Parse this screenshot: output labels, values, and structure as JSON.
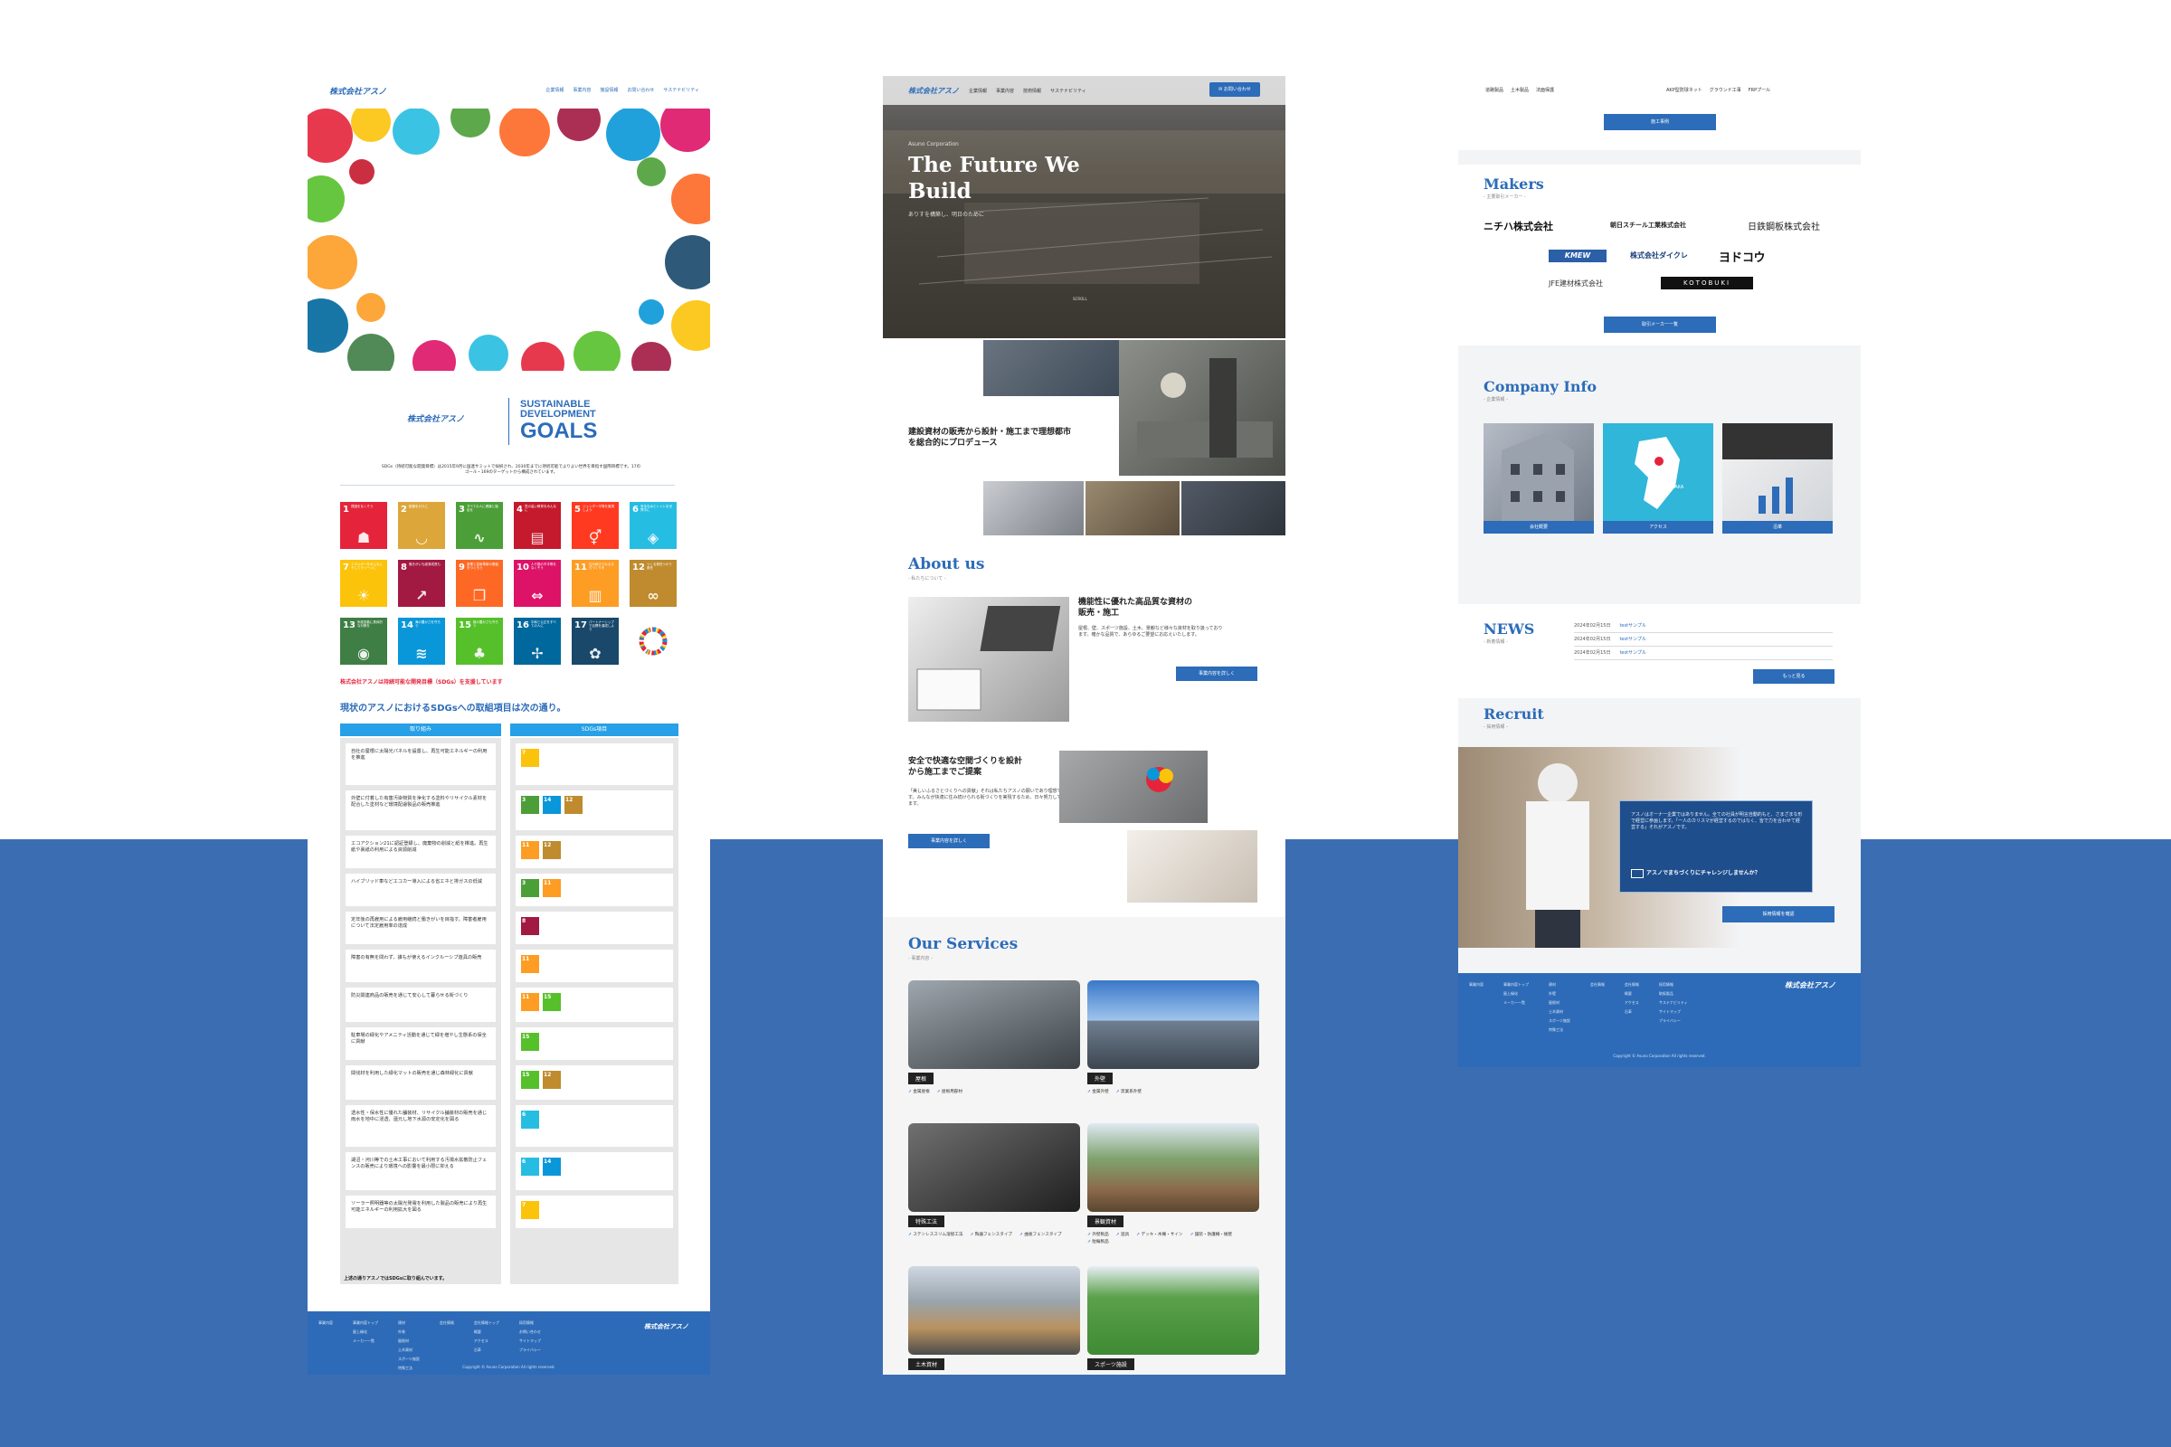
{
  "colors": {
    "band": "#3b6db3",
    "brand": "#2c6cb9",
    "sdg_red": "#e5243b"
  },
  "p1": {
    "logo": "株式会社アスノ",
    "nav": [
      "企業情報",
      "事業内容",
      "施設情報",
      "お問い合わせ",
      "サステナビリティ"
    ],
    "sdg_logo_line1": "SUSTAINABLE",
    "sdg_logo_line2": "DEVELOPMENT",
    "sdg_logo_line3": "GOALS",
    "intro": "SDGs（持続可能な開発目標）は2015年9月に国連サミットで採択され、2030年までに持続可能でよりよい世界を目指す国際目標です。17のゴール・169のターゲットから構成されています。",
    "support": "株式会社アスノは持続可能な開発目標（SDGs）を支援しています",
    "heading": "現状のアスノにおけるSDGsへの取組項目は次の通り。",
    "col1": "取り組み",
    "col2": "SDGs項目",
    "rows": [
      "自社の屋根に太陽光パネルを設置し、再生可能エネルギーの利用を推進",
      "外壁に付着した有害汚染物質を浄化する塗料やリサイクル素材を配合した塗材など環境配慮製品の販売推進",
      "エコアクション21に認証登録し、廃棄物の削減と紙を推進。再生紙や裏紙の利用による資源削減",
      "ハイブリッド車などエコカー導入による省エネと排ガスの低減",
      "定年後の再雇用による雇用継続と働きがいを目指す。障害者雇用について法定雇用率の達成",
      "障害の有無を問わず、誰もが使えるインクルーシブ遊具の販売",
      "防災関連商品の販売を通じて安心して暮らせる街づくり",
      "駐車場の緑化やアメニティ活動を通じて緑を増やし生態系の保全に貢献",
      "間伐材を利用した緑化マットの販売を通じ森林緑化に貢献",
      "透水性・保水性に優れた舗装材、リサイクル舗装材の販売を通じ雨水を地中に浸透、還元し地下水源の安定化を図る",
      "湖沼・河川等での土木工事において利用する汚濁水拡散防止フェンスの販売により環境への影響を最小限に抑える",
      "ソーラー照明器等の太陽光発電を利用した製品の販売により再生可能エネルギーの利用拡大を図る"
    ],
    "closing": "上述の通りアスノではSDGsに取り組んでいます。",
    "footer_cols": [
      [
        "事業内容"
      ],
      [
        "事業内容トップ",
        "屋上緑化",
        "メーカー一覧"
      ],
      [
        "建材",
        "外装",
        "屋根材",
        "土木資材",
        "スポーツ施設",
        "特殊工法"
      ],
      [
        "会社情報"
      ],
      [
        "会社情報トップ",
        "概要",
        "アクセス",
        "沿革"
      ],
      [
        "採用情報",
        "お問い合わせ",
        "サイトマップ",
        "プライバシー"
      ]
    ],
    "copyright": "Copyright © Asuno Corporation All rights reserved."
  },
  "sdg_goals": [
    {
      "n": "1",
      "label": "貧困をなくそう",
      "color": "#e5243b",
      "icon": "family-icon"
    },
    {
      "n": "2",
      "label": "飢餓をゼロに",
      "color": "#dda63a",
      "icon": "bowl-icon"
    },
    {
      "n": "3",
      "label": "すべての人に健康と福祉を",
      "color": "#4c9f38",
      "icon": "heartbeat-icon"
    },
    {
      "n": "4",
      "label": "質の高い教育をみんなに",
      "color": "#c5192d",
      "icon": "book-icon"
    },
    {
      "n": "5",
      "label": "ジェンダー平等を実現しよう",
      "color": "#ff3a21",
      "icon": "gender-icon"
    },
    {
      "n": "6",
      "label": "安全な水とトイレを世界中に",
      "color": "#26bde2",
      "icon": "water-icon"
    },
    {
      "n": "7",
      "label": "エネルギーをみんなにそしてクリーンに",
      "color": "#fcc30b",
      "icon": "sun-icon"
    },
    {
      "n": "8",
      "label": "働きがいも経済成長も",
      "color": "#a21942",
      "icon": "growth-icon"
    },
    {
      "n": "9",
      "label": "産業と技術革新の基盤をつくろう",
      "color": "#fd6925",
      "icon": "cubes-icon"
    },
    {
      "n": "10",
      "label": "人や国の不平等をなくそう",
      "color": "#dd1367",
      "icon": "equality-icon"
    },
    {
      "n": "11",
      "label": "住み続けられるまちづくりを",
      "color": "#fd9d24",
      "icon": "city-icon"
    },
    {
      "n": "12",
      "label": "つくる責任つかう責任",
      "color": "#bf8b2e",
      "icon": "infinity-icon"
    },
    {
      "n": "13",
      "label": "気候変動に具体的な対策を",
      "color": "#3f7e44",
      "icon": "eye-icon"
    },
    {
      "n": "14",
      "label": "海の豊かさを守ろう",
      "color": "#0a97d9",
      "icon": "fish-icon"
    },
    {
      "n": "15",
      "label": "陸の豊かさも守ろう",
      "color": "#56c02b",
      "icon": "tree-icon"
    },
    {
      "n": "16",
      "label": "平和と公正をすべての人に",
      "color": "#00689d",
      "icon": "dove-icon"
    },
    {
      "n": "17",
      "label": "パートナーシップで目標を達成しよう",
      "color": "#19486a",
      "icon": "flower-icon"
    }
  ],
  "p2": {
    "logo": "株式会社アスノ",
    "nav": [
      "企業情報",
      "事業内容",
      "技術情報",
      "サステナビリティ"
    ],
    "contact": "お問い合わせ",
    "hero_kicker": "Asuno Corporation",
    "hero_title1": "The Future We",
    "hero_title2": "Build",
    "hero_sub": "ありすを構築し、明日のために",
    "scroll": "SCROLL",
    "tagline1": "建設資材の販売から設計・施工まで理想都市",
    "tagline2": "を総合的にプロデュース",
    "about_title": "About us",
    "about_sub": "- 私たちについて -",
    "about_h1": "機能性に優れた高品質な資材の",
    "about_h2": "販売・施工",
    "about_body": "屋根、壁、スポーツ施設、土木、景観など様々な資材を取り扱っております。確かな品質で、あらゆるご要望にお応えいたします。",
    "about_btn": "事業内容を詳しく",
    "safe_h1": "安全で快適な空間づくりを設計",
    "safe_h2": "から施工までご提案",
    "safe_body": "「美しいふるさとづくりへの貢献」それは私たちアスノの願いであり理想です。みんなが快適に住み続けられる街づくりを実現するため、日々努力しています。",
    "safe_btn": "事業内容を詳しく",
    "services_title": "Our Services",
    "services_sub": "- 事業内容 -",
    "services": [
      {
        "name": "屋根",
        "tags": [
          "金属屋根",
          "屋根用部材"
        ]
      },
      {
        "name": "外壁",
        "tags": [
          "金属外壁",
          "窯業系外壁"
        ]
      },
      {
        "name": "特殊工法",
        "tags": [
          "ステンレススリム溶接工法",
          "陶器フェンスタイプ",
          "曲板フェンスタイプ"
        ]
      },
      {
        "name": "景観資材",
        "tags": [
          "外壁製品",
          "遊具",
          "デッキ・木柵・サイン",
          "舗装・防護柵・擁壁",
          "駐輪製品"
        ]
      },
      {
        "name": "土木資材",
        "tags": [
          "道路製品",
          "土木製品",
          "法面保護"
        ]
      },
      {
        "name": "スポーツ施設",
        "tags": [
          "AKP型球技ネット",
          "グラウンド工事",
          "FRPプール"
        ]
      }
    ]
  },
  "p3": {
    "top_tags_left": [
      "道路製品",
      "土木製品",
      "法面保護"
    ],
    "top_tags_right": [
      "AKP型防球ネット",
      "グラウンド工事",
      "FRPプール"
    ],
    "works_btn": "施工事例",
    "makers_title": "Makers",
    "makers_sub": "- 主要取引メーカー -",
    "makers": [
      "ニチハ株式会社",
      "朝日スチール工業株式会社",
      "日鉄鋼板株式会社",
      "KMEW",
      "株式会社ダイクレ",
      "ヨドコウ",
      "JFE建材株式会社",
      "KOTOBUKI"
    ],
    "makers_btn": "取引メーカー一覧",
    "company_title": "Company Info",
    "company_sub": "- 企業情報 -",
    "company_cards": [
      "会社概要",
      "アクセス",
      "沿革"
    ],
    "map_label": "OSAKA",
    "news_title": "NEWS",
    "news_sub": "- 新着情報 -",
    "news": [
      {
        "date": "2024年02月15日",
        "title": "testサンプル"
      },
      {
        "date": "2024年02月15日",
        "title": "testサンプル"
      },
      {
        "date": "2024年02月15日",
        "title": "testサンプル"
      }
    ],
    "news_btn": "もっと見る",
    "recruit_title": "Recruit",
    "recruit_sub": "- 採用情報 -",
    "recruit_body": "アスノはオーナー企業ではありません。全ての社員が明言自動的もと、さまざまな形で経営に参画します。「一人のカリスマが経営するのではなく、皆で力を合わせて経営する」それがアスノです。",
    "recruit_cta": "アスノでまちづくりにチャレンジしませんか？",
    "recruit_btn": "採用情報を確認",
    "footer_cols": [
      [
        "事業内容"
      ],
      [
        "事業内容トップ",
        "屋上緑化",
        "メーカー一覧"
      ],
      [
        "建材",
        "外壁",
        "屋根材",
        "土木資材",
        "スポーツ施設",
        "特殊工法"
      ],
      [
        "会社情報"
      ],
      [
        "会社情報",
        "概要",
        "アクセス",
        "沿革"
      ],
      [
        "採用情報",
        "取扱製品",
        "サステナビリティ",
        "サイトマップ",
        "プライバシー"
      ]
    ],
    "logo": "株式会社アスノ",
    "copyright": "Copyright © Asuno Corporation All rights reserved."
  }
}
